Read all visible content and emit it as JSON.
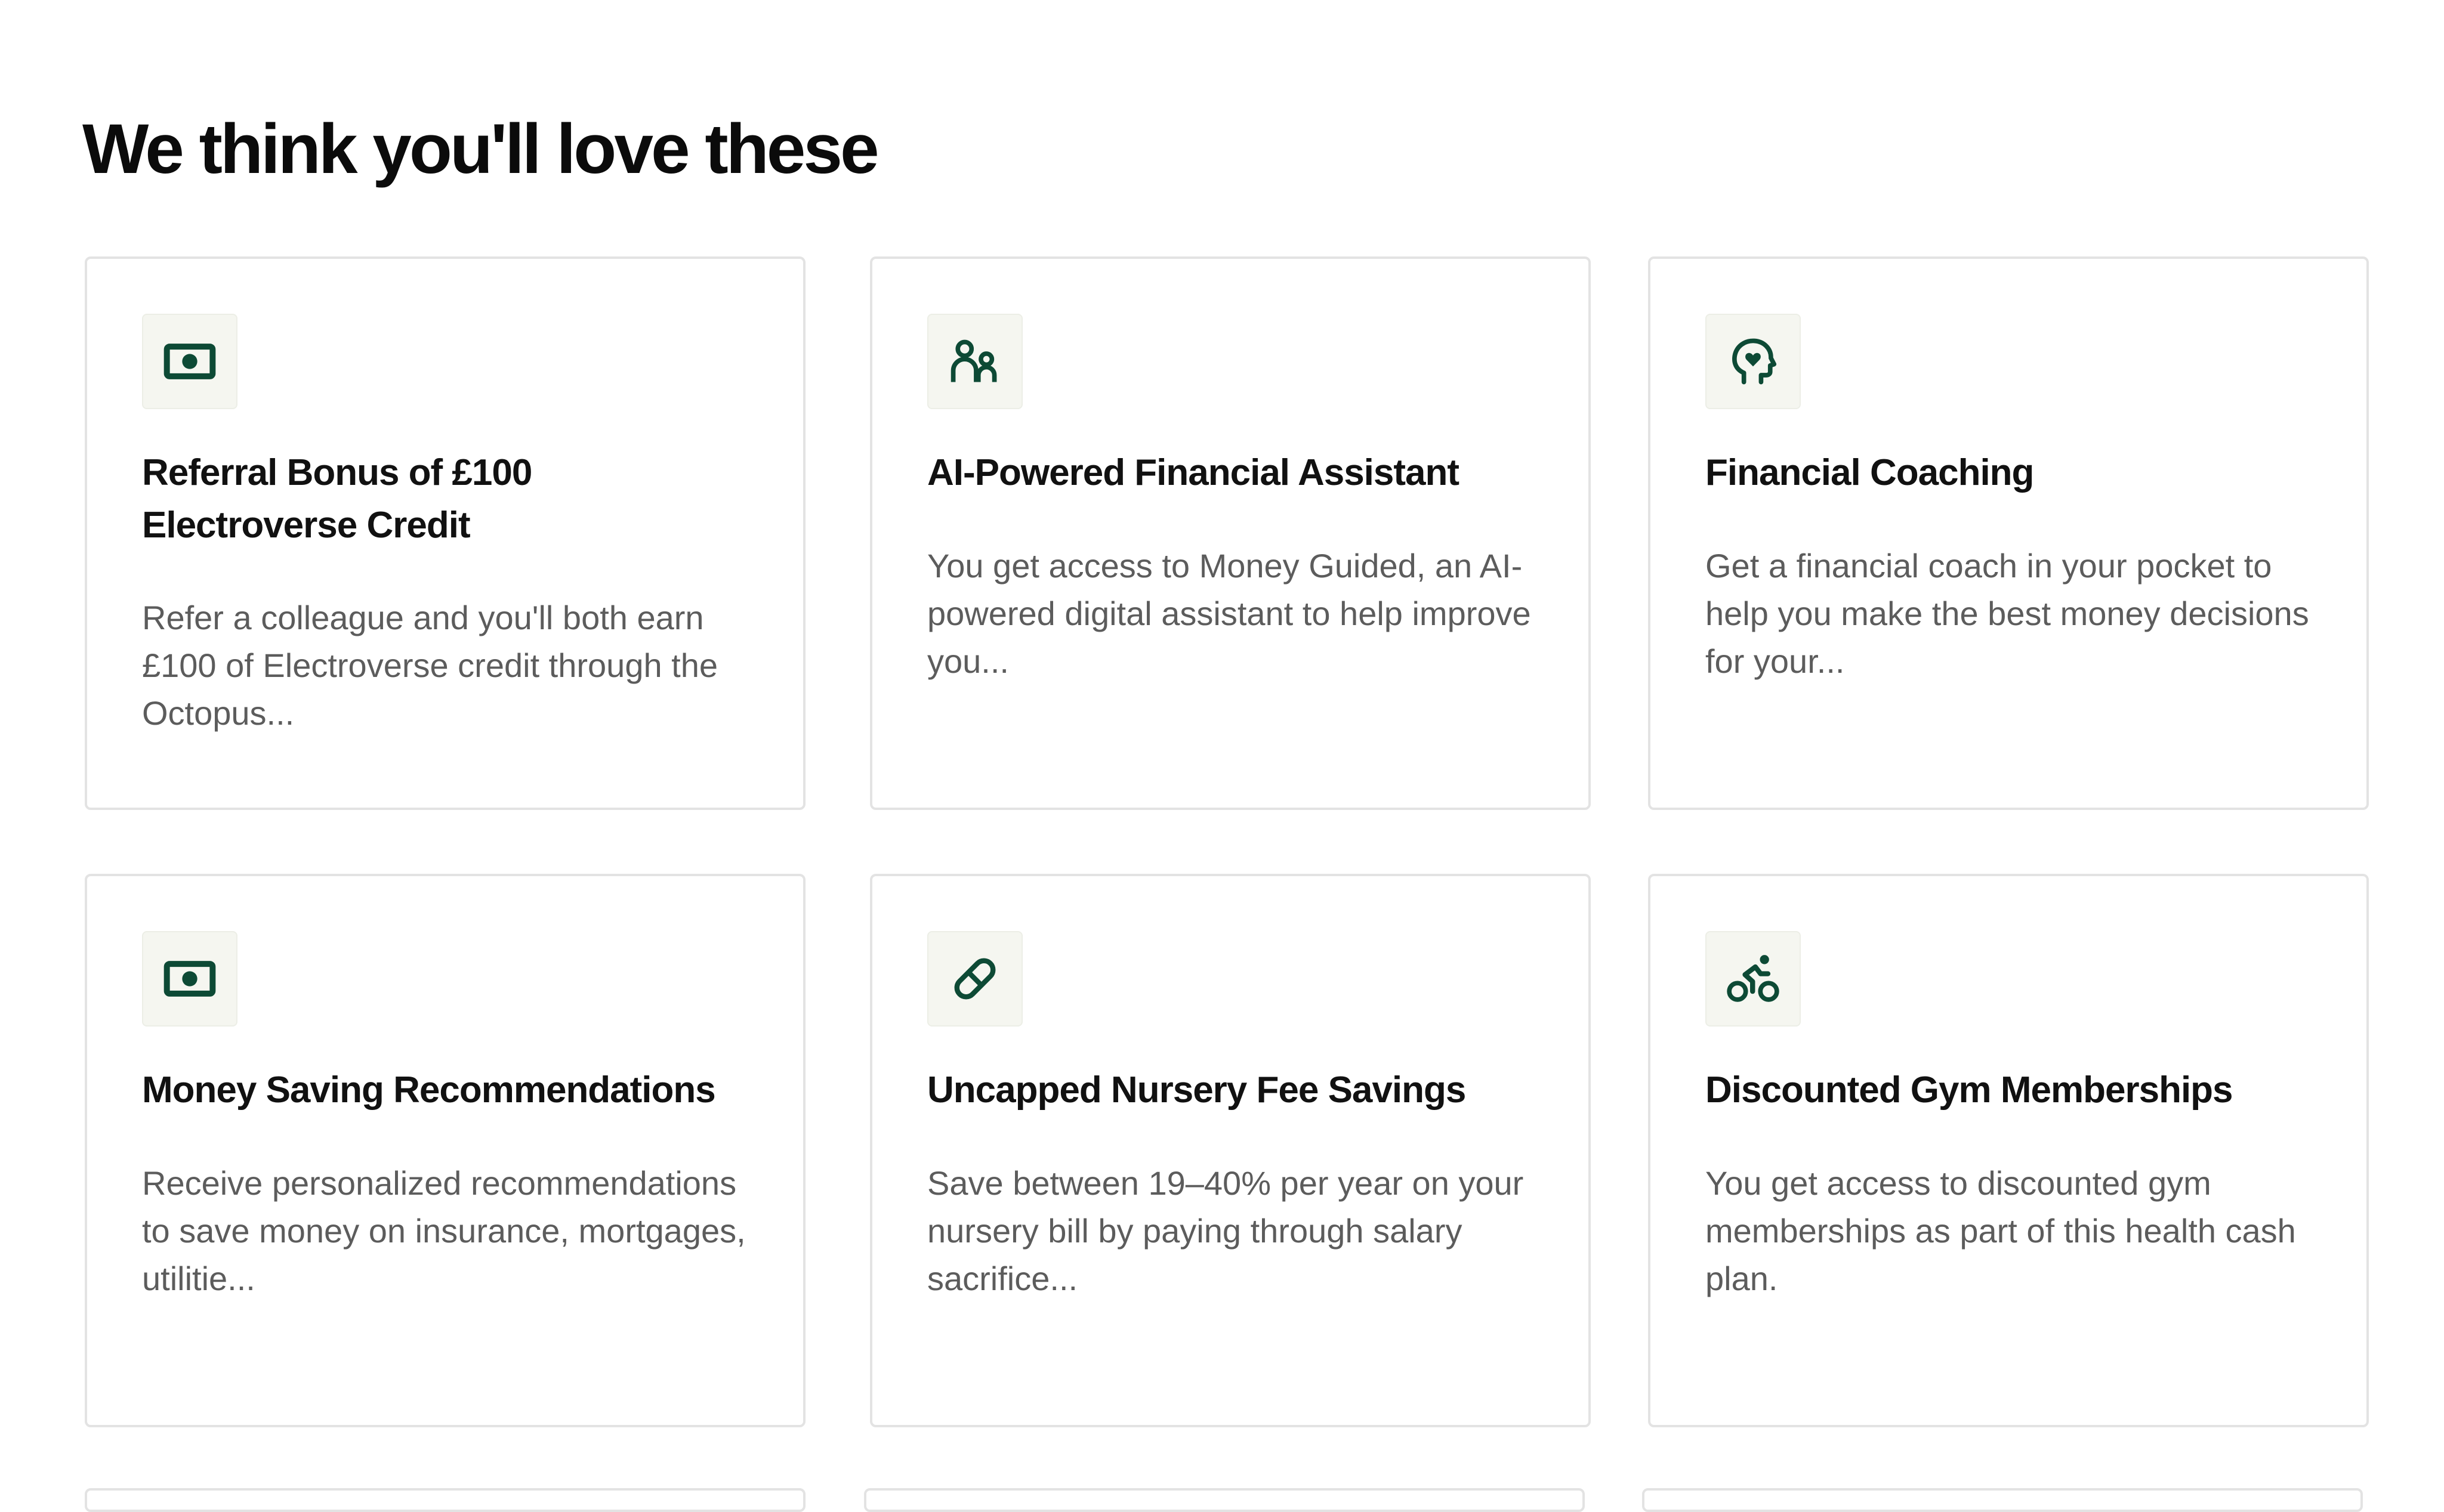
{
  "page": {
    "title": "We think you'll love these"
  },
  "theme": {
    "icon_color": "#0d4a35",
    "icon_tile_bg": "#f5f6f0",
    "card_border": "#e3e3e3",
    "description_color": "#5c5c5c"
  },
  "cards": [
    {
      "icon": "banknote-icon",
      "title": "Referral Bonus of £100 Electroverse Credit",
      "description": "Refer a colleague and you'll both earn £100 of Electroverse credit through the Octopus..."
    },
    {
      "icon": "people-icon",
      "title": "AI-Powered Financial Assistant",
      "description": "You get access to Money Guided, an AI-powered digital assistant to help improve you..."
    },
    {
      "icon": "head-heart-icon",
      "title": "Financial Coaching",
      "description": "Get a financial coach in your pocket to help you make the best money decisions for your..."
    },
    {
      "icon": "banknote-icon",
      "title": "Money Saving Recommendations",
      "description": "Receive personalized recommendations to save money on insurance, mortgages, utilitie..."
    },
    {
      "icon": "pill-icon",
      "title": "Uncapped Nursery Fee Savings",
      "description": "Save between 19–40% per year on your nursery bill by paying through salary sacrifice..."
    },
    {
      "icon": "cyclist-icon",
      "title": "Discounted Gym Memberships",
      "description": "You get access to discounted gym memberships as part of this health cash plan."
    }
  ]
}
